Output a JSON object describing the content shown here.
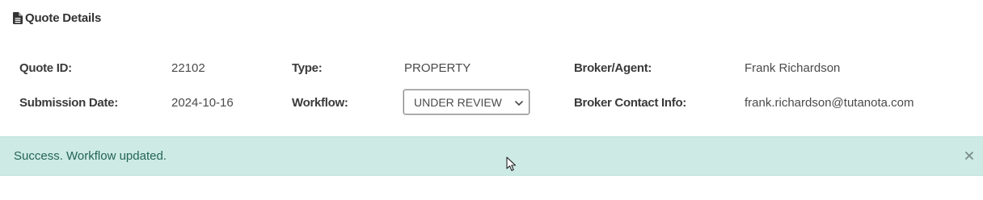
{
  "section": {
    "title": "Quote Details",
    "icon": "file-icon"
  },
  "details": {
    "quote_id_label": "Quote ID:",
    "quote_id_value": "22102",
    "type_label": "Type:",
    "type_value": "PROPERTY",
    "broker_label": "Broker/Agent:",
    "broker_value": "Frank Richardson",
    "submission_date_label": "Submission Date:",
    "submission_date_value": "2024-10-16",
    "workflow_label": "Workflow:",
    "workflow_value": "UNDER REVIEW",
    "broker_contact_label": "Broker Contact Info:",
    "broker_contact_value": "frank.richardson@tutanota.com"
  },
  "alert": {
    "message": "Success. Workflow updated.",
    "close_icon": "close-icon",
    "background_color": "#cdeae4",
    "text_color": "#236458"
  },
  "cursor": {
    "icon": "mouse-pointer-icon"
  }
}
